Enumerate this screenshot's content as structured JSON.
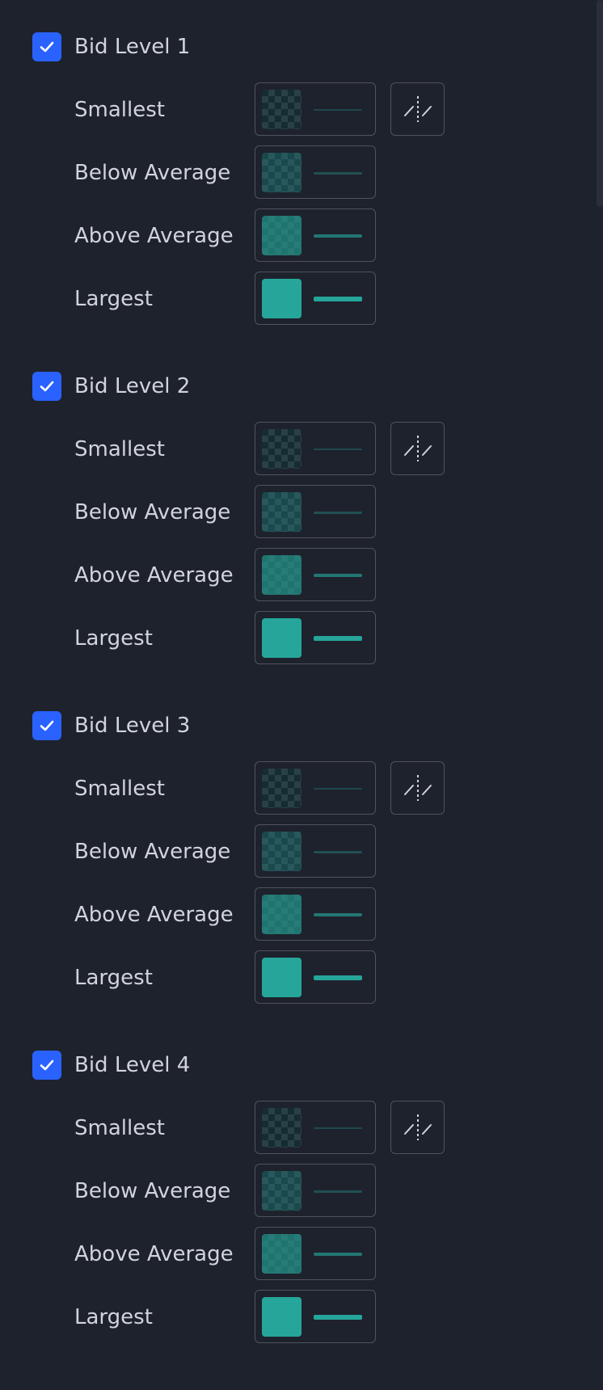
{
  "accent_color": "#2962ff",
  "series_color": "#26a69a",
  "levels": [
    {
      "title": "Bid Level 1",
      "checked": true,
      "rows": [
        {
          "label": "Smallest",
          "opacity": 0.15
        },
        {
          "label": "Below Average",
          "opacity": 0.35
        },
        {
          "label": "Above Average",
          "opacity": 0.65
        },
        {
          "label": "Largest",
          "opacity": 1.0
        }
      ]
    },
    {
      "title": "Bid Level 2",
      "checked": true,
      "rows": [
        {
          "label": "Smallest",
          "opacity": 0.15
        },
        {
          "label": "Below Average",
          "opacity": 0.35
        },
        {
          "label": "Above Average",
          "opacity": 0.65
        },
        {
          "label": "Largest",
          "opacity": 1.0
        }
      ]
    },
    {
      "title": "Bid Level 3",
      "checked": true,
      "rows": [
        {
          "label": "Smallest",
          "opacity": 0.15
        },
        {
          "label": "Below Average",
          "opacity": 0.35
        },
        {
          "label": "Above Average",
          "opacity": 0.65
        },
        {
          "label": "Largest",
          "opacity": 1.0
        }
      ]
    },
    {
      "title": "Bid Level 4",
      "checked": true,
      "rows": [
        {
          "label": "Smallest",
          "opacity": 0.15
        },
        {
          "label": "Below Average",
          "opacity": 0.35
        },
        {
          "label": "Above Average",
          "opacity": 0.65
        },
        {
          "label": "Largest",
          "opacity": 1.0
        }
      ]
    }
  ],
  "icons": {
    "checkbox": "checkmark-icon",
    "interpolation": "interpolation-icon"
  }
}
